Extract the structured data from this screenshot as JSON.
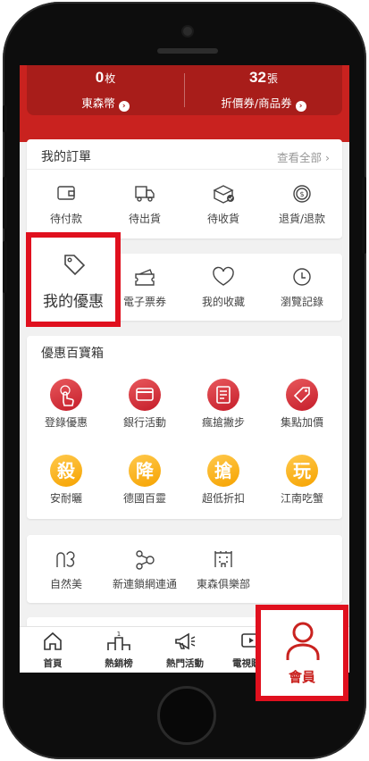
{
  "top": {
    "points": {
      "value": "0",
      "unit": "枚",
      "label": "東森幣"
    },
    "coupons": {
      "value": "32",
      "unit": "張",
      "label": "折價券/商品券"
    }
  },
  "orders": {
    "title": "我的訂單",
    "more": "查看全部",
    "items": [
      {
        "label": "待付款",
        "icon": "wallet-icon"
      },
      {
        "label": "待出貨",
        "icon": "truck-icon"
      },
      {
        "label": "待收貨",
        "icon": "box-check-icon"
      },
      {
        "label": "退貨/退款",
        "icon": "refund-coin-icon"
      }
    ]
  },
  "quick": {
    "items": [
      {
        "label": "我的優惠",
        "icon": "tag-icon"
      },
      {
        "label": "電子票券",
        "icon": "ticket-icon"
      },
      {
        "label": "我的收藏",
        "icon": "heart-icon"
      },
      {
        "label": "瀏覽記錄",
        "icon": "clock-icon"
      }
    ]
  },
  "deals": {
    "title": "優惠百寶箱",
    "row1": [
      {
        "label": "登錄優惠",
        "icon": "tap-finger-icon"
      },
      {
        "label": "銀行活動",
        "icon": "credit-card-icon"
      },
      {
        "label": "瘋搶撇步",
        "icon": "notebook-icon"
      },
      {
        "label": "集點加價",
        "icon": "price-tag-icon"
      }
    ],
    "row2": [
      {
        "label": "安耐曬",
        "badge": "殺"
      },
      {
        "label": "德國百靈",
        "badge": "降"
      },
      {
        "label": "超低折扣",
        "badge": "搶"
      },
      {
        "label": "江南吃蟹",
        "badge": "玩"
      }
    ]
  },
  "partners": {
    "items": [
      {
        "label": "自然美",
        "icon": "n3-logo-icon"
      },
      {
        "label": "新連鎖網連通",
        "icon": "network-icon"
      },
      {
        "label": "東森俱樂部",
        "icon": "building-icon"
      }
    ]
  },
  "nav": {
    "items": [
      {
        "label": "首頁",
        "icon": "home-icon"
      },
      {
        "label": "熱銷榜",
        "icon": "podium-icon",
        "badge": "1"
      },
      {
        "label": "熱門活動",
        "icon": "megaphone-icon"
      },
      {
        "label": "電視購物",
        "icon": "tv-play-icon"
      }
    ],
    "member": {
      "label": "會員",
      "icon": "person-icon"
    }
  },
  "colors": {
    "brand_red": "#c9221f",
    "highlight": "#e0101e",
    "badge_orange": "#f6a300"
  }
}
